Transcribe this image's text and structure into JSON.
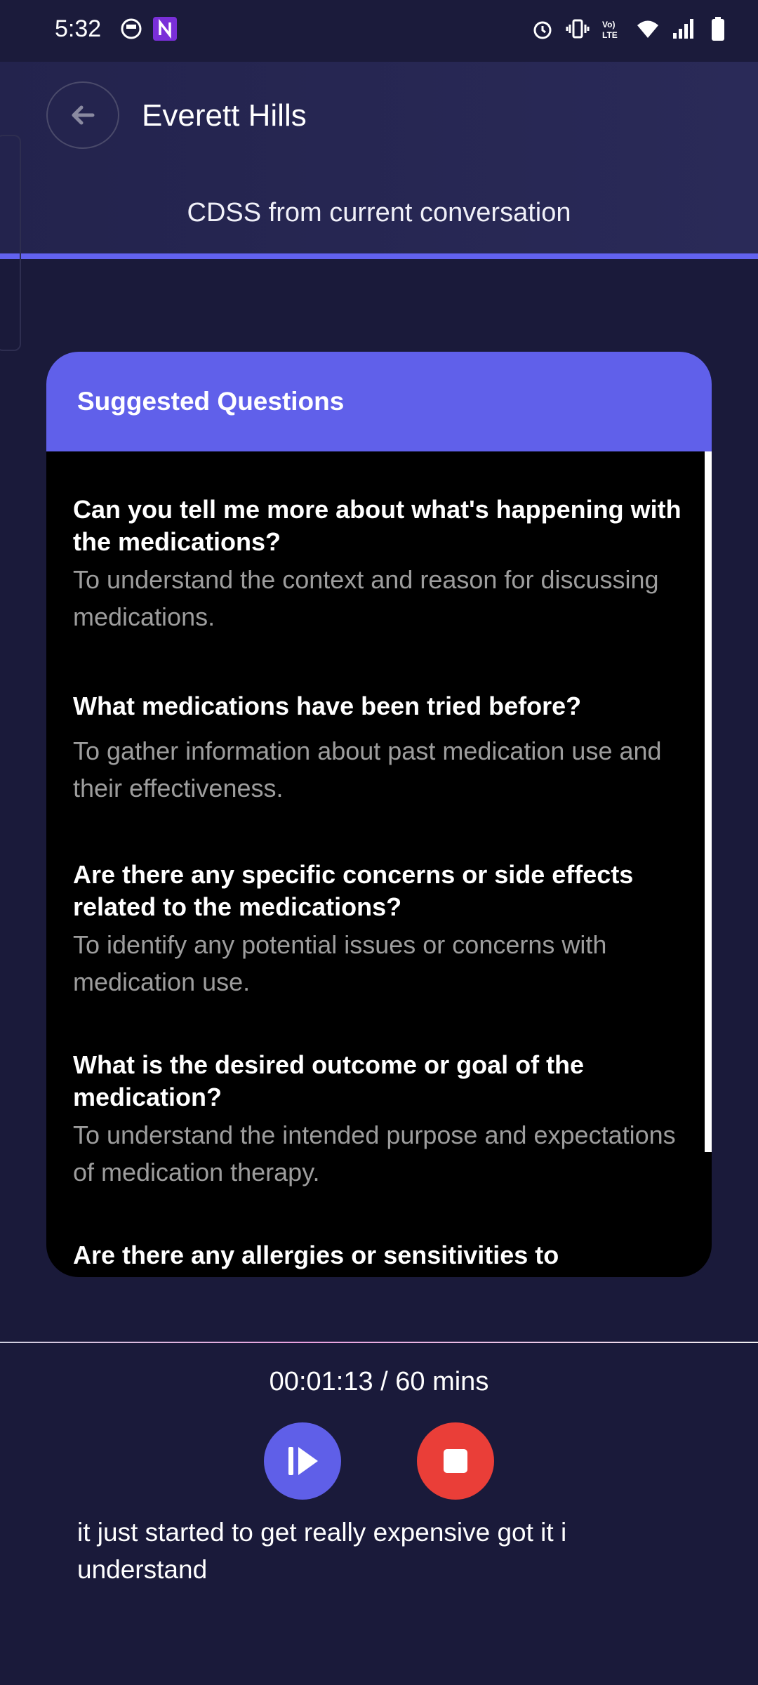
{
  "status_bar": {
    "time": "5:32",
    "left_icons": [
      "face-icon",
      "n-app-icon"
    ],
    "right_icons": [
      "alarm-icon",
      "vibrate-icon",
      "volte-icon",
      "wifi-icon",
      "signal-icon",
      "battery-icon"
    ]
  },
  "header": {
    "patient_name": "Everett Hills",
    "subtitle": "CDSS from current conversation"
  },
  "card": {
    "title": "Suggested Questions",
    "questions": [
      {
        "question": "Can you tell me more about what's happening with the medications?",
        "reason": "To understand the context and reason for discussing medications."
      },
      {
        "question": "What medications have been tried before?",
        "reason": "To gather information about past medication use and their effectiveness."
      },
      {
        "question": "Are there any specific concerns or side effects related to the medications?",
        "reason": "To identify any potential issues or concerns with medication use."
      },
      {
        "question": "What is the desired outcome or goal of the medication?",
        "reason": "To understand the intended purpose and expectations of medication therapy."
      },
      {
        "question": "Are there any allergies or sensitivities to",
        "reason": ""
      }
    ]
  },
  "recording": {
    "timer": "00:01:13 / 60 mins",
    "transcript": "it just started to get really expensive got it i understand"
  },
  "colors": {
    "background": "#1a1a3a",
    "accent": "#6060ea",
    "stop": "#ea3e38"
  }
}
